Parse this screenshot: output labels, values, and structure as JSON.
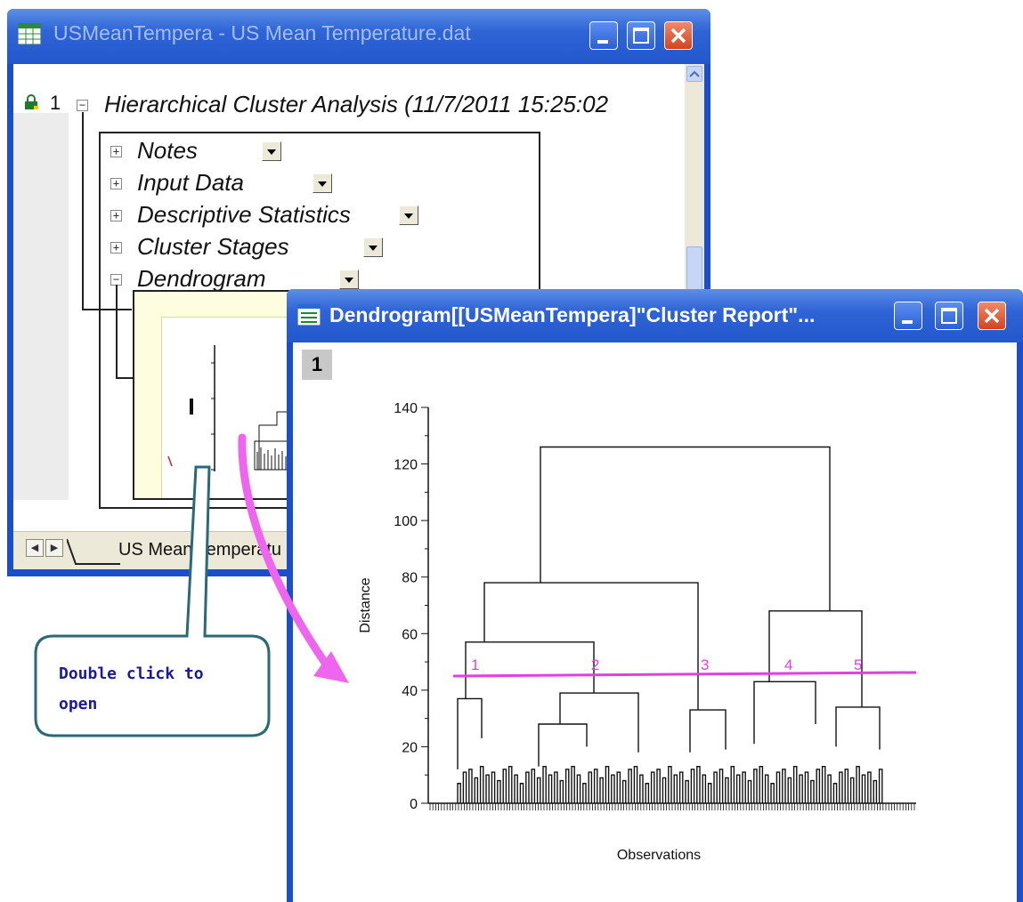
{
  "back_window": {
    "title": "USMeanTempera - US Mean Temperature.dat",
    "row_number": "1",
    "report_title": "Hierarchical Cluster Analysis (11/7/2011 15:25:02",
    "tree_items": [
      {
        "label": "Notes",
        "expanded": false
      },
      {
        "label": "Input Data",
        "expanded": false
      },
      {
        "label": "Descriptive Statistics",
        "expanded": false
      },
      {
        "label": "Cluster Stages",
        "expanded": false
      },
      {
        "label": "Dendrogram",
        "expanded": true
      }
    ],
    "sheet_tab": "US Mean Temperatu"
  },
  "front_window": {
    "title": "Dendrogram[[USMeanTempera]\"Cluster Report\"...",
    "layer": "1"
  },
  "callout": {
    "text": "Double click to\nopen"
  },
  "colors": {
    "cut_line": "#e040e0",
    "arrow": "#ee66ee",
    "title_bar": "#2258cc",
    "close_button": "#d4421e",
    "callout_border": "#2a6a78"
  },
  "chart_data": {
    "type": "dendrogram",
    "xlabel": "Observations",
    "ylabel": "Distance",
    "ylim": [
      0,
      140
    ],
    "yticks": [
      "0",
      "20",
      "40",
      "60",
      "80",
      "100",
      "120",
      "140"
    ],
    "major_merges": [
      {
        "height": 126,
        "between": [
          "A+B",
          "C+D"
        ]
      },
      {
        "height": 78,
        "between": [
          "A",
          "B"
        ]
      },
      {
        "height": 68,
        "between": [
          "C",
          "D"
        ]
      },
      {
        "height": 57,
        "between": [
          "cluster 1",
          "cluster 2"
        ]
      },
      {
        "height": 43,
        "between": [
          "cluster 4 left",
          "cluster 4 right"
        ]
      },
      {
        "height": 39,
        "between": [
          "cluster 2 left",
          "cluster 2 right"
        ]
      },
      {
        "height": 37,
        "between": [
          "cluster 1 left",
          "cluster 1 right"
        ]
      },
      {
        "height": 34,
        "between": [
          "cluster 5 left",
          "cluster 5 right"
        ]
      },
      {
        "height": 33,
        "between": [
          "cluster 3 left",
          "cluster 3 right"
        ]
      }
    ],
    "cut_line": {
      "distance": 45,
      "cluster_labels": [
        "1",
        "2",
        "3",
        "4",
        "5"
      ]
    }
  }
}
